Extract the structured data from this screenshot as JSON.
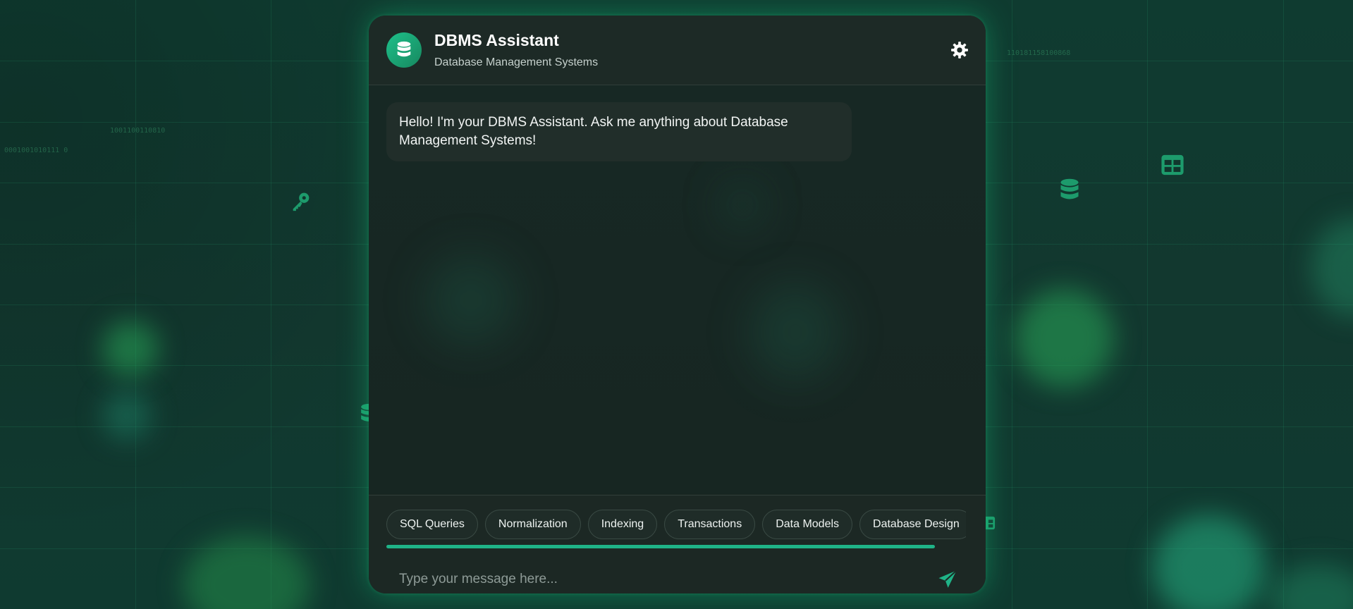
{
  "header": {
    "title": "DBMS Assistant",
    "subtitle": "Database Management Systems"
  },
  "chat": {
    "messages": [
      {
        "role": "assistant",
        "text": "Hello! I'm your DBMS Assistant. Ask me anything about Database Management Systems!"
      }
    ]
  },
  "topics": [
    "SQL Queries",
    "Normalization",
    "Indexing",
    "Transactions",
    "Data Models",
    "Database Design"
  ],
  "composer": {
    "placeholder": "Type your message here..."
  },
  "background": {
    "binary_strings": [
      "110181158100868",
      "1001100110810",
      "0001001010111 0"
    ],
    "icons": [
      "key-icon",
      "database-icon",
      "table-icon",
      "database-icon",
      "table-icon"
    ]
  },
  "colors": {
    "accent": "#1fb387",
    "panel": "#1a2622",
    "background": "#11362d"
  }
}
